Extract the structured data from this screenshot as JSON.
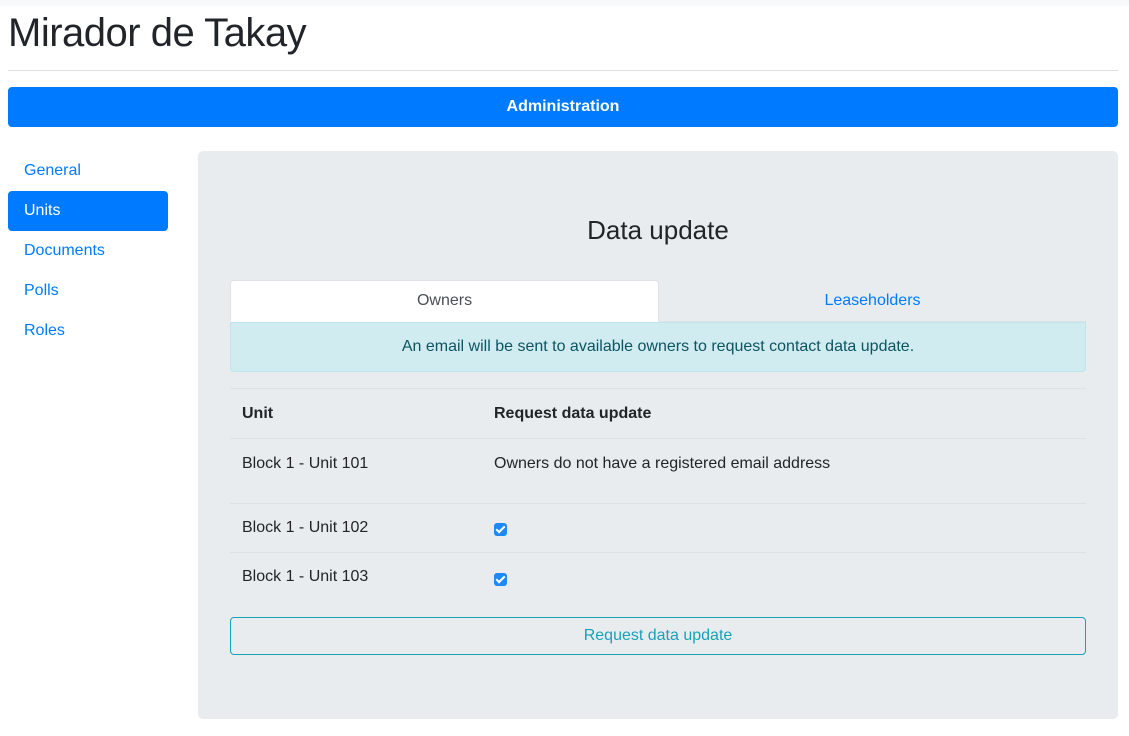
{
  "site": {
    "title": "Mirador de Takay"
  },
  "admin_bar": {
    "label": "Administration"
  },
  "sidebar": {
    "items": [
      {
        "label": "General",
        "active": false
      },
      {
        "label": "Units",
        "active": true
      },
      {
        "label": "Documents",
        "active": false
      },
      {
        "label": "Polls",
        "active": false
      },
      {
        "label": "Roles",
        "active": false
      }
    ]
  },
  "panel": {
    "title": "Data update",
    "tabs": [
      {
        "label": "Owners",
        "active": true
      },
      {
        "label": "Leaseholders",
        "active": false
      }
    ],
    "alert": "An email will be sent to available owners to request contact data update.",
    "table": {
      "headers": [
        "Unit",
        "Request data update"
      ],
      "rows": [
        {
          "unit": "Block 1 - Unit 101",
          "status": "Owners do not have a registered email address"
        },
        {
          "unit": "Block 1 - Unit 102",
          "checked": true
        },
        {
          "unit": "Block 1 - Unit 103",
          "checked": true
        }
      ]
    },
    "button": "Request data update"
  },
  "colors": {
    "primary": "#007bff",
    "info": "#17a2b8",
    "alert_bg": "#d1ecf1",
    "panel_bg": "#e9ecef"
  }
}
